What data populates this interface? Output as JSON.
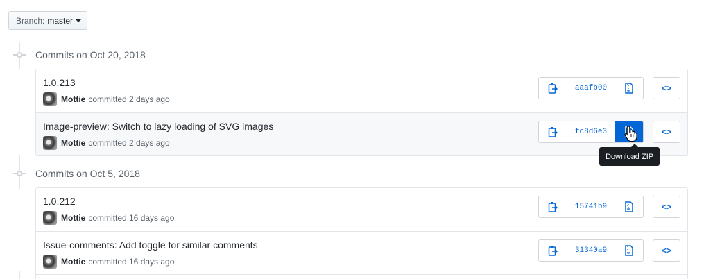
{
  "branch": {
    "label": "Branch:",
    "value": "master"
  },
  "groups": [
    {
      "title": "Commits on Oct 20, 2018",
      "commits": [
        {
          "message": "1.0.213",
          "author": "Mottie",
          "time": "committed 2 days ago",
          "sha": "aaafb00"
        },
        {
          "message": "Image-preview: Switch to lazy loading of SVG images",
          "author": "Mottie",
          "time": "committed 2 days ago",
          "sha": "fc8d6e3"
        }
      ]
    },
    {
      "title": "Commits on Oct 5, 2018",
      "commits": [
        {
          "message": "1.0.212",
          "author": "Mottie",
          "time": "committed 16 days ago",
          "sha": "15741b9"
        },
        {
          "message": "Issue-comments: Add toggle for similar comments",
          "author": "Mottie",
          "time": "committed 16 days ago",
          "sha": "31340a9"
        }
      ]
    }
  ],
  "tooltip": "Download ZIP",
  "browse_label": "<>",
  "icons": {
    "copy": "clipboard-icon",
    "zip": "file-zip-icon",
    "browse": "code-icon",
    "cursor": "hand-pointer-icon"
  },
  "colors": {
    "link": "#0366d6",
    "active_button": "#0366d6",
    "hover_row": "#f6f8fa",
    "tooltip_bg": "#1b1f23"
  }
}
